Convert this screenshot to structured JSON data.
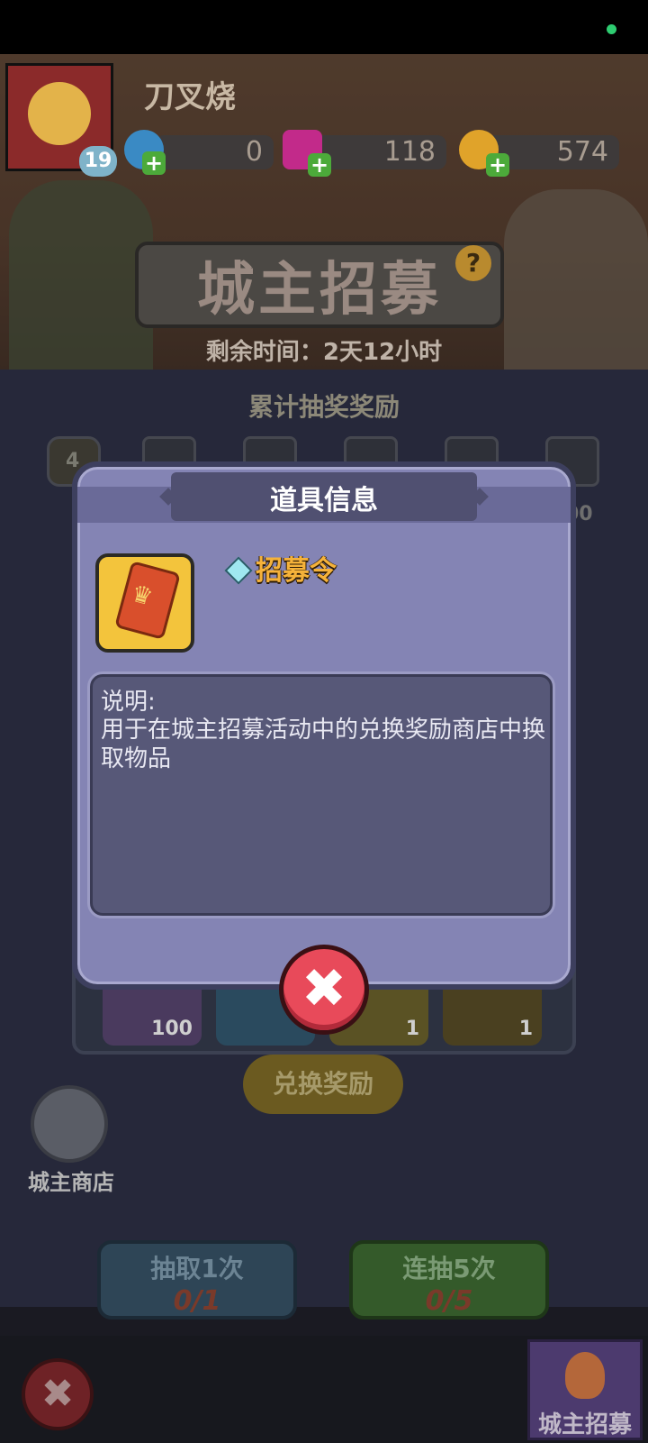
{
  "player": {
    "name": "刀叉烧",
    "level": "19"
  },
  "resources": [
    {
      "name": "crystal",
      "value": "0",
      "color": "#3a8ac4"
    },
    {
      "name": "gem",
      "value": "118",
      "color": "#c22a8a"
    },
    {
      "name": "gold",
      "value": "574",
      "color": "#e0a32a"
    }
  ],
  "event": {
    "title": "城主招募",
    "help": "?",
    "remaining": "剩余时间：2天12小时"
  },
  "cumulative": {
    "title": "累计抽奖奖励",
    "first_count": "4",
    "last_count": "00"
  },
  "exchange": {
    "qty": [
      "100",
      "",
      "1",
      "1"
    ],
    "button": "兑换奖励"
  },
  "shop": {
    "label": "城主商店"
  },
  "draws": [
    {
      "label": "抽取1次",
      "count": "0/1"
    },
    {
      "label": "连抽5次",
      "count": "0/5"
    }
  ],
  "bottom": {
    "tab_label": "城主招募",
    "close_symbol": "✖"
  },
  "modal": {
    "title": "道具信息",
    "item_name": "招募令",
    "desc_label": "说明:",
    "desc_text": "用于在城主招募活动中的兑换奖励商店中换取物品",
    "close_symbol": "✖"
  }
}
